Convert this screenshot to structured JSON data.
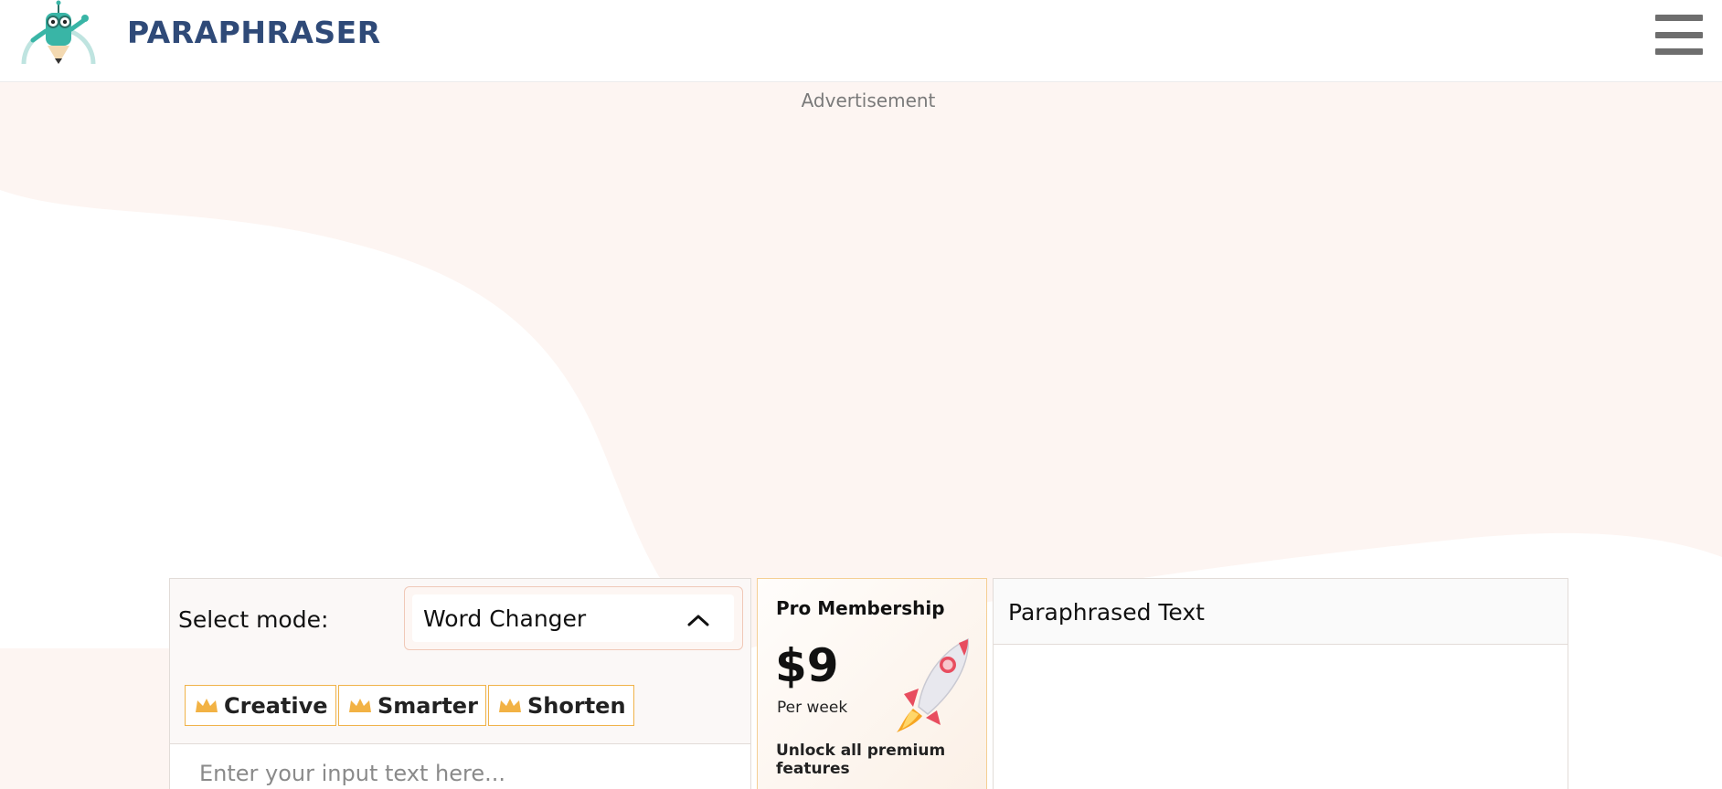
{
  "header": {
    "brand": "PARAPHRASER",
    "logo_icon": "pencil-robot-mascot-icon",
    "menu_icon": "hamburger-menu-icon"
  },
  "ad": {
    "label": "Advertisement"
  },
  "input_panel": {
    "select_label": "Select mode:",
    "selected_mode": "Word Changer",
    "chips": [
      {
        "label": "Creative",
        "icon": "crown-icon"
      },
      {
        "label": "Smarter",
        "icon": "crown-icon"
      },
      {
        "label": "Shorten",
        "icon": "crown-icon"
      }
    ],
    "input_placeholder": "Enter your input text here..."
  },
  "promo": {
    "title": "Pro Membership",
    "price": "$9",
    "period": "Per week",
    "unlock_text": "Unlock all premium features",
    "icon": "rocket-icon"
  },
  "output_panel": {
    "title": "Paraphrased Text"
  },
  "colors": {
    "brand": "#2f4a78",
    "crown": "#f0b34a",
    "promo_border": "#f5cf94",
    "background_wave": "#fdf4f1"
  }
}
